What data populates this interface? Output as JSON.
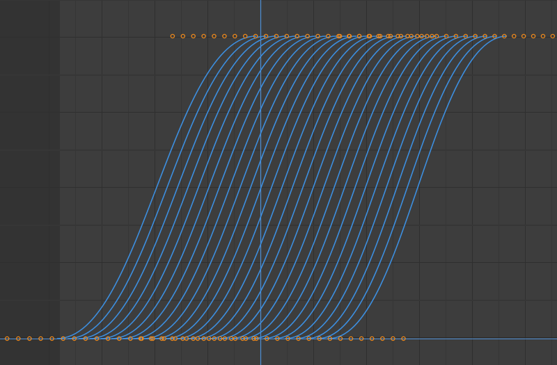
{
  "editor": {
    "type": "graph-editor",
    "colors": {
      "background": "#3d3d3d",
      "sidebar_shade": "#333333",
      "grid_minor": "#363636",
      "grid_major": "#2f2f2f",
      "curve": "#3d8fe0",
      "keyframe_handle": "#f08a1c",
      "cursor": "#4f8fd6"
    }
  },
  "curve_family": {
    "count": 26,
    "shape": "ease-in-out",
    "value_low": 0,
    "value_high": 1,
    "handles_per_curve": 2
  },
  "icons": {
    "keyframe": "keyframe-handle-icon"
  }
}
